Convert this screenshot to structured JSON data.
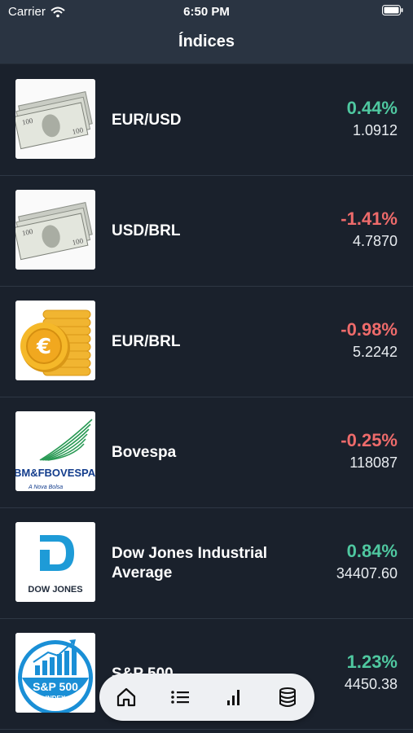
{
  "status_bar": {
    "carrier": "Carrier",
    "time": "6:50 PM"
  },
  "header": {
    "title": "Índices"
  },
  "items": [
    {
      "name": "EUR/USD",
      "change": "0.44%",
      "value": "1.0912",
      "trend": "up"
    },
    {
      "name": "USD/BRL",
      "change": "-1.41%",
      "value": "4.7870",
      "trend": "down"
    },
    {
      "name": "EUR/BRL",
      "change": "-0.98%",
      "value": "5.2242",
      "trend": "down"
    },
    {
      "name": "Bovespa",
      "change": "-0.25%",
      "value": "118087",
      "trend": "down",
      "logo_text": "BM&FBOVESPA",
      "logo_subtext": "A Nova Bolsa"
    },
    {
      "name": "Dow Jones Industrial Average",
      "change": "0.84%",
      "value": "34407.60",
      "trend": "up",
      "logo_text": "DOW JONES"
    },
    {
      "name": "S&P 500",
      "change": "1.23%",
      "value": "4450.38",
      "trend": "up",
      "logo_text": "S&P 500",
      "logo_subtext": "INDEX"
    }
  ],
  "tab_bar": {
    "tabs": [
      "home-icon",
      "list-icon",
      "chart-icon",
      "database-icon"
    ]
  },
  "colors": {
    "positive": "#4fc8a0",
    "negative": "#ee6b6b",
    "background": "#1a212c",
    "header": "#2a3442"
  }
}
